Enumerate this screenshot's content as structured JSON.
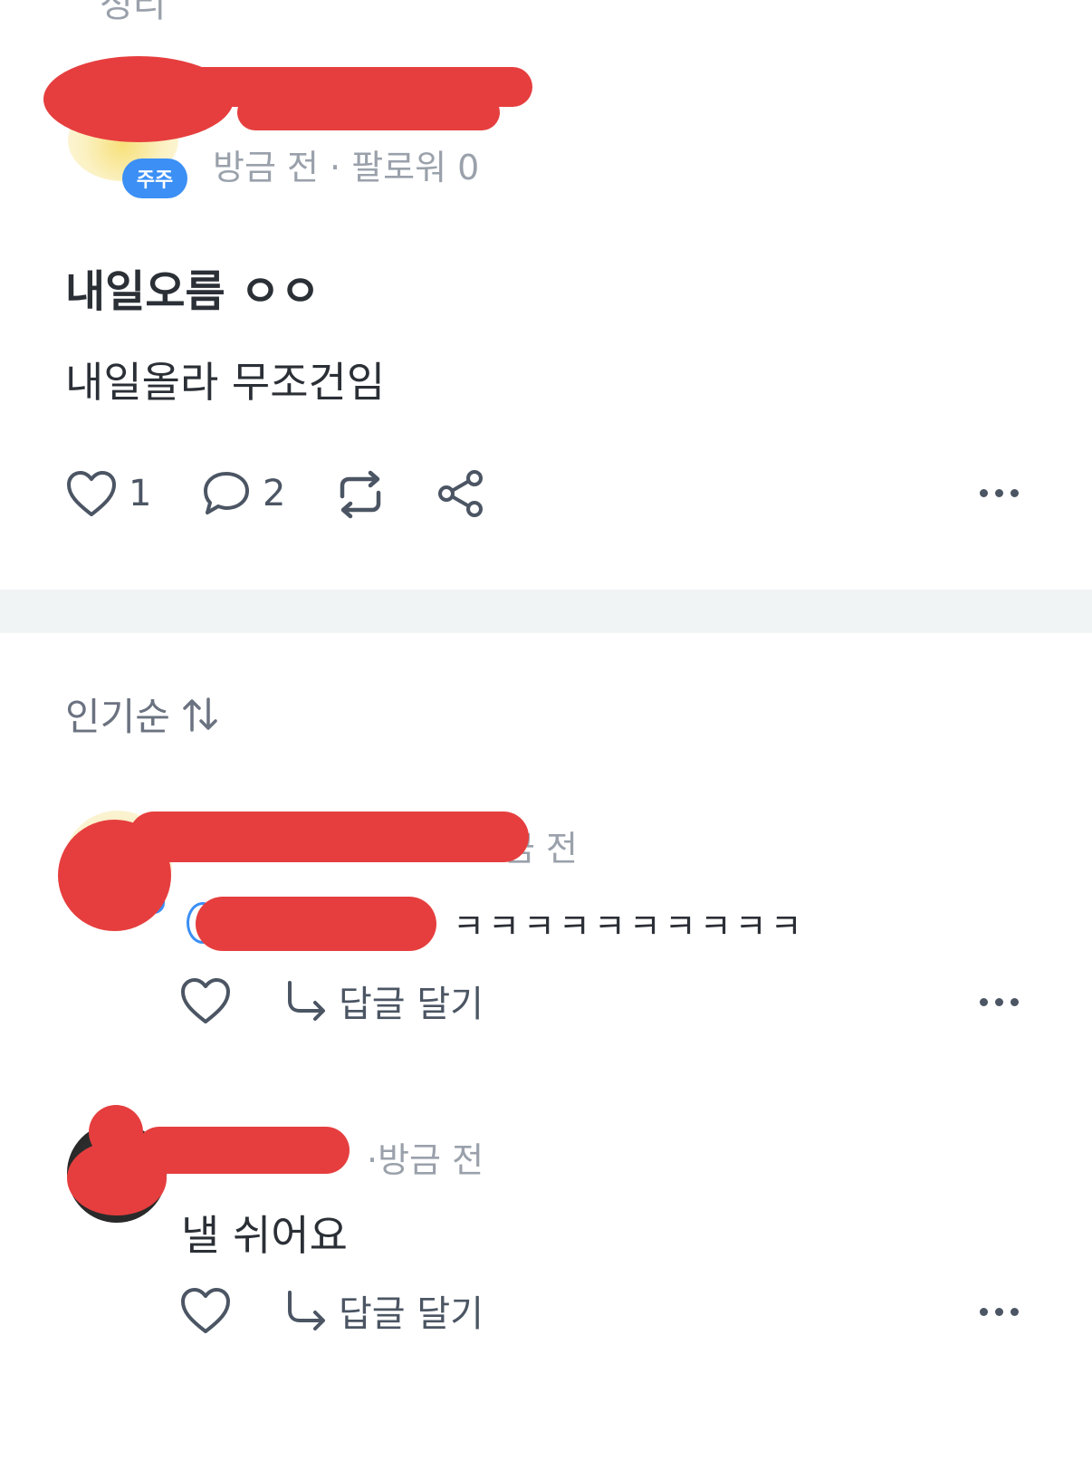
{
  "post": {
    "top_cut_text": "정리",
    "author_badge": "주주",
    "meta": "방금 전 · 팔로워 0",
    "title": "내일오름 ㅇㅇ",
    "body": "내일올라 무조건임",
    "like_count": "1",
    "comment_count": "2"
  },
  "comments_section": {
    "sort_label": "인기순",
    "comments": [
      {
        "meta_visible": "금 전",
        "text": "ㅋㅋㅋㅋㅋㅋㅋㅋㅋㅋ",
        "reply_label": "답글 달기"
      },
      {
        "meta_visible": "·방금 전",
        "text": "낼 쉬어요",
        "reply_label": "답글 달기"
      }
    ]
  },
  "colors": {
    "accent_badge": "#3b8ff5",
    "redaction": "#e63e3e",
    "meta_gray": "#9aa1ab",
    "divider": "#f1f4f5"
  },
  "icons": {
    "like": "heart-icon",
    "comment": "chat-bubble-icon",
    "repost": "repost-icon",
    "share": "share-icon",
    "more": "more-horizontal-icon",
    "sort": "sort-arrows-icon",
    "reply": "reply-arrow-icon"
  }
}
